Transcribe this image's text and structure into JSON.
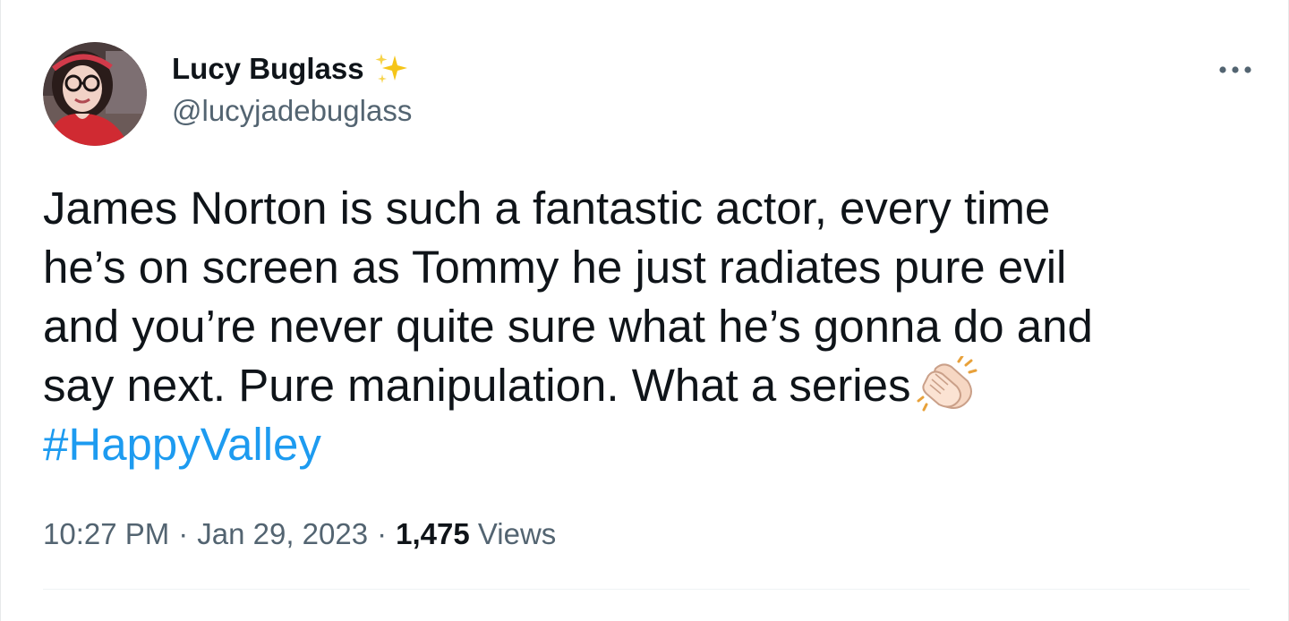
{
  "tweet": {
    "author": {
      "display_name": "Lucy Buglass",
      "handle": "@lucyjadebuglass",
      "badge_icon": "sparkles-icon"
    },
    "text_lines": [
      "James Norton is such a fantastic actor, every time",
      "he’s on screen as Tommy he just radiates pure evil",
      "and you’re never quite sure what he’s gonna do and",
      "say next. Pure manipulation. What a series"
    ],
    "emoji_icon": "clapping-hands-icon",
    "hashtag": "#HappyValley",
    "time": "10:27 PM",
    "separator": "·",
    "date": "Jan 29, 2023",
    "views_count": "1,475",
    "views_label": "Views"
  },
  "colors": {
    "text": "#0f1419",
    "secondary_text": "#536471",
    "link": "#1d9bf0",
    "divider": "#eff3f4"
  }
}
